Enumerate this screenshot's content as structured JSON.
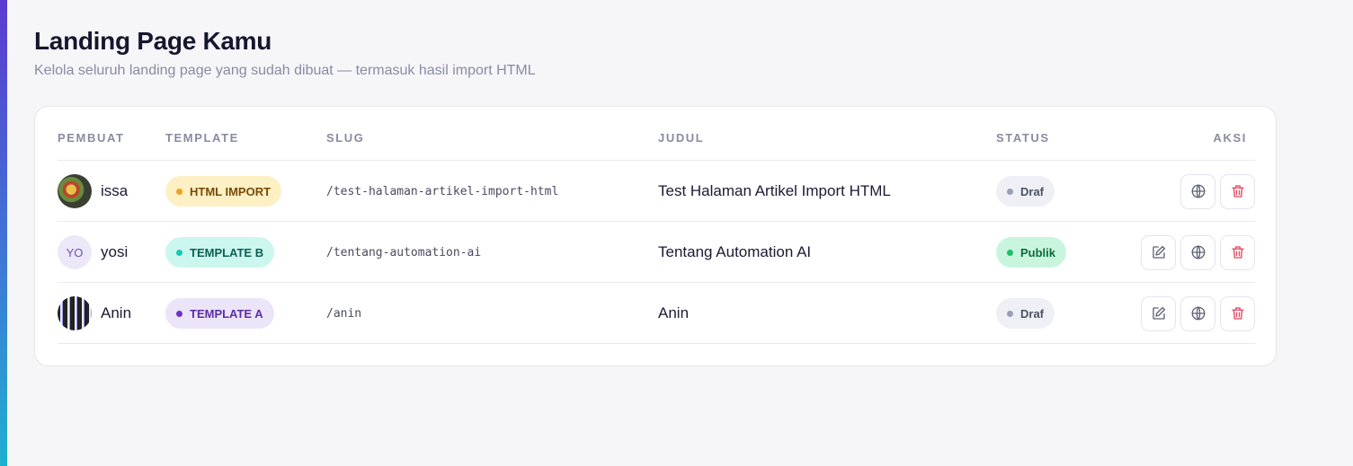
{
  "page": {
    "title": "Landing Page Kamu",
    "subtitle": "Kelola seluruh landing page yang sudah dibuat — termasuk hasil import HTML"
  },
  "table": {
    "headers": {
      "pembuat": "PEMBUAT",
      "template": "TEMPLATE",
      "slug": "SLUG",
      "judul": "JUDUL",
      "status": "STATUS",
      "aksi": "AKSI"
    },
    "rows": [
      {
        "creator": "issa",
        "avatar_initials": "",
        "template": "HTML IMPORT",
        "slug": "/test-halaman-artikel-import-html",
        "title": "Test Halaman Artikel Import HTML",
        "status": "Draf",
        "actions": [
          "globe-icon",
          "trash-icon"
        ]
      },
      {
        "creator": "yosi",
        "avatar_initials": "YO",
        "template": "TEMPLATE B",
        "slug": "/tentang-automation-ai",
        "title": "Tentang Automation AI",
        "status": "Publik",
        "actions": [
          "edit-icon",
          "globe-icon",
          "trash-icon"
        ]
      },
      {
        "creator": "Anin",
        "avatar_initials": "",
        "template": "TEMPLATE A",
        "slug": "/anin",
        "title": "Anin",
        "status": "Draf",
        "actions": [
          "edit-icon",
          "globe-icon",
          "trash-icon"
        ]
      }
    ]
  },
  "colors": {
    "accent_gradient_top": "#5b3bcf",
    "accent_gradient_bottom": "#1fb0d0",
    "trash_icon": "#e0465f",
    "status_publik": "#1cbf6a"
  }
}
